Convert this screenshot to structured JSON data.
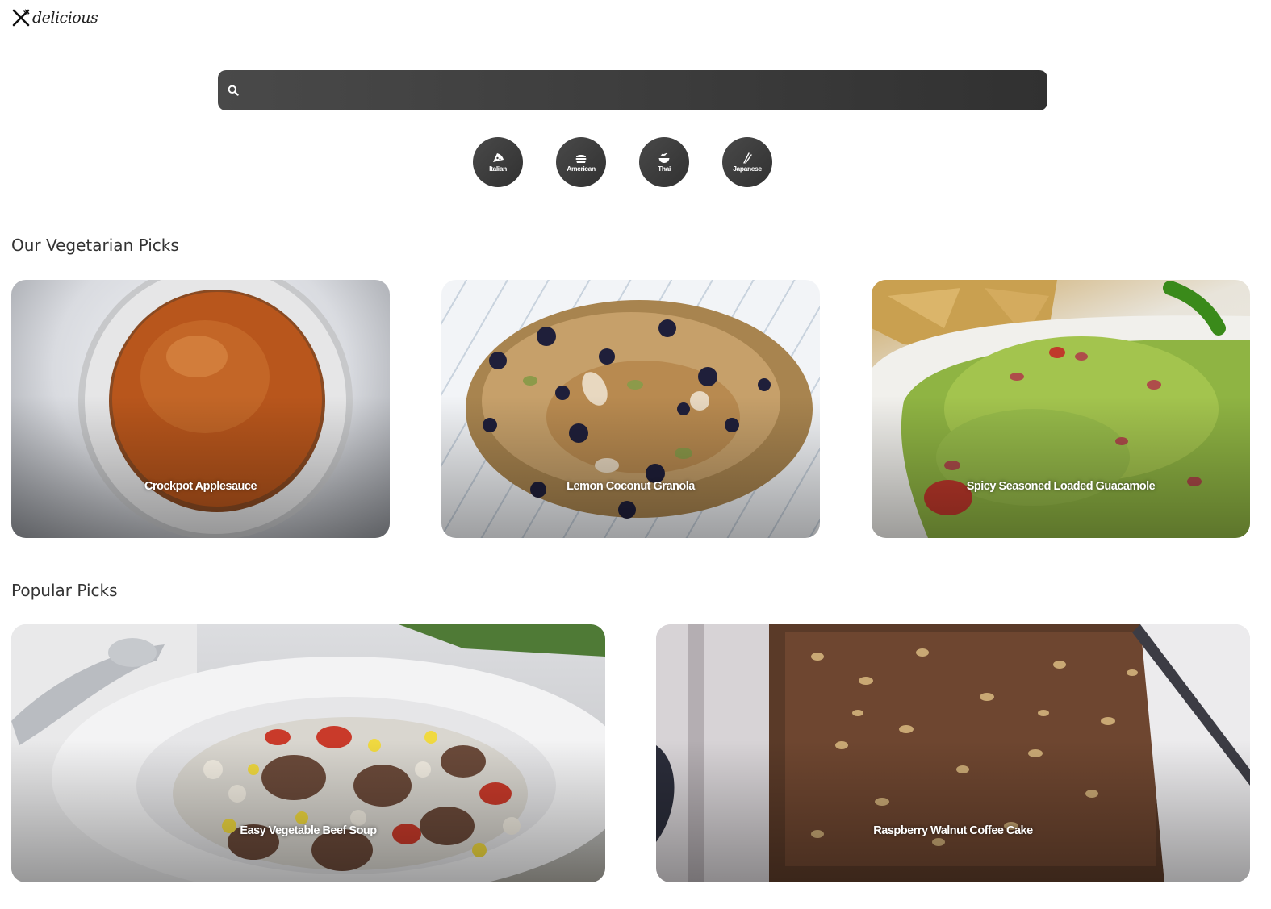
{
  "app": {
    "logo_text": "delicious"
  },
  "search": {
    "placeholder": "",
    "value": ""
  },
  "cuisines": [
    {
      "label": "Italian",
      "icon": "pizza-icon"
    },
    {
      "label": "American",
      "icon": "burger-icon"
    },
    {
      "label": "Thai",
      "icon": "noodle-bowl-icon"
    },
    {
      "label": "Japanese",
      "icon": "chopsticks-icon"
    }
  ],
  "vegetarian": {
    "title": "Our Vegetarian Picks",
    "recipes": [
      {
        "title": "Crockpot Applesauce"
      },
      {
        "title": "Lemon Coconut Granola"
      },
      {
        "title": "Spicy Seasoned Loaded Guacamole"
      }
    ]
  },
  "popular": {
    "title": "Popular Picks",
    "recipes": [
      {
        "title": "Easy Vegetable Beef Soup"
      },
      {
        "title": "Raspberry Walnut Coffee Cake"
      }
    ]
  },
  "colors": {
    "accent_dark": "#313131",
    "accent_light": "#494949",
    "text": "#333333"
  }
}
